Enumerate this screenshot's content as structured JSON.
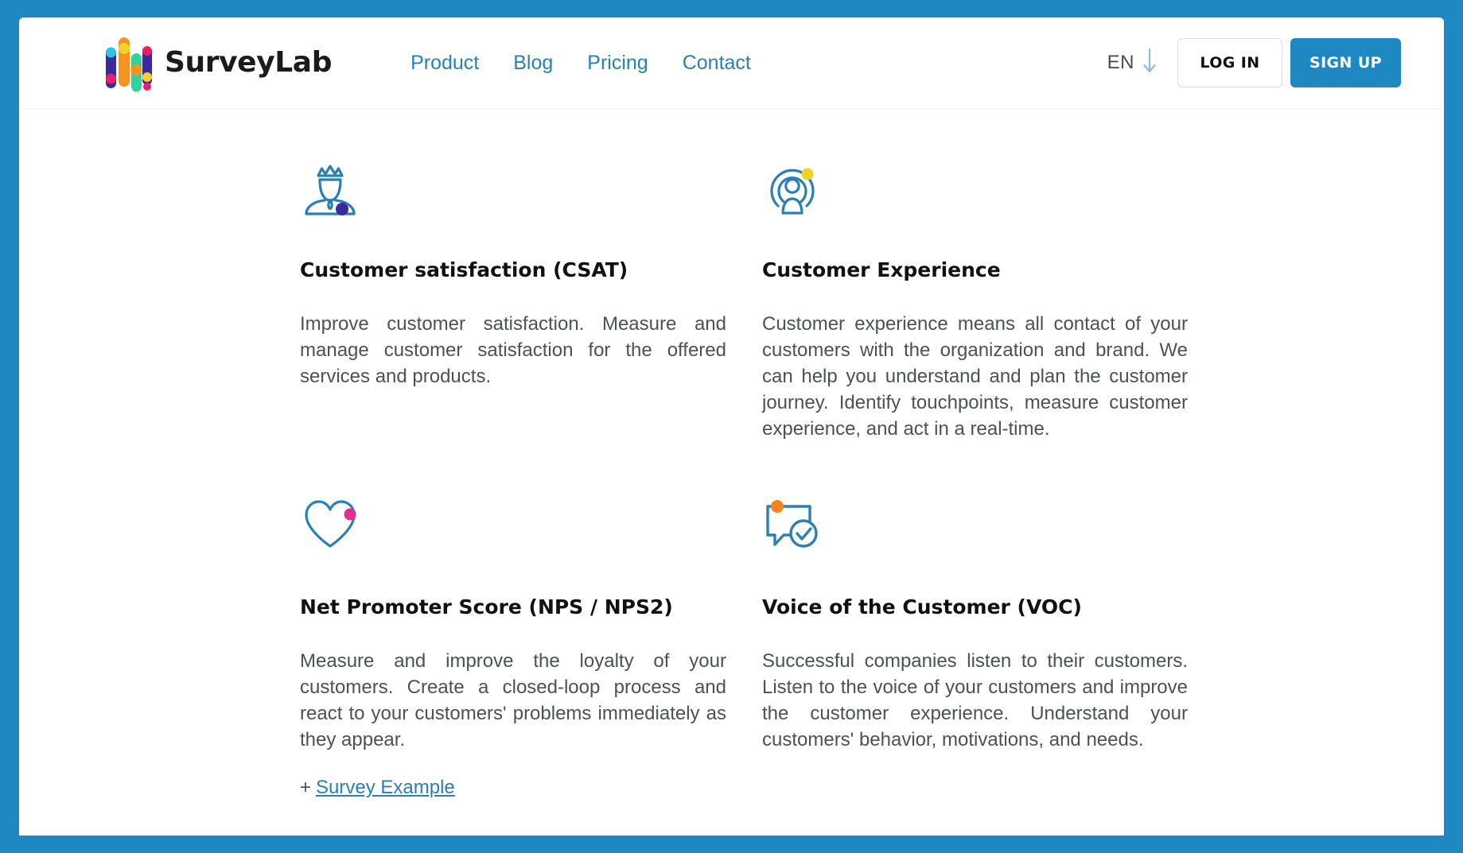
{
  "site": {
    "brand_name": "SurveyLab",
    "accent_color": "#1e88c3",
    "link_color": "#2a7fb5",
    "frame_color": "#1e88c3"
  },
  "header": {
    "logo_icon": "surveylab-bars-logo",
    "nav": [
      {
        "label": "Product",
        "name": "nav-product"
      },
      {
        "label": "Blog",
        "name": "nav-blog"
      },
      {
        "label": "Pricing",
        "name": "nav-pricing"
      },
      {
        "label": "Contact",
        "name": "nav-contact"
      }
    ],
    "language": {
      "label": "EN",
      "icon": "down-arrow-icon"
    },
    "login_label": "LOG IN",
    "signup_label": "SIGN UP"
  },
  "cards": [
    {
      "icon": "crowned-person-icon",
      "title": "Customer satisfaction (CSAT)",
      "body": "Improve customer satisfaction. Measure and manage customer satisfaction for the offered services and products.",
      "link": null,
      "link_prefix": null
    },
    {
      "icon": "broadcast-person-icon",
      "title": "Customer Experience",
      "body": "Customer experience means all contact of your customers with the organization and brand. We can help you understand and plan the customer journey. Identify touchpoints, measure customer experience, and act in a real-time.",
      "link": null,
      "link_prefix": null
    },
    {
      "icon": "heart-outline-icon",
      "title": "Net Promoter Score (NPS / NPS2)",
      "body": "Measure and improve the loyalty of your customers. Create a closed-loop process and react to your customers' problems immediately as they appear.",
      "link": "Survey Example",
      "link_prefix": "+"
    },
    {
      "icon": "speech-bubble-check-icon",
      "title": "Voice of the Customer (VOC)",
      "body": "Successful companies listen to their customers. Listen to the voice of your customers and improve the customer experience. Understand your customers' behavior, motivations, and needs.",
      "link": null,
      "link_prefix": null
    }
  ]
}
